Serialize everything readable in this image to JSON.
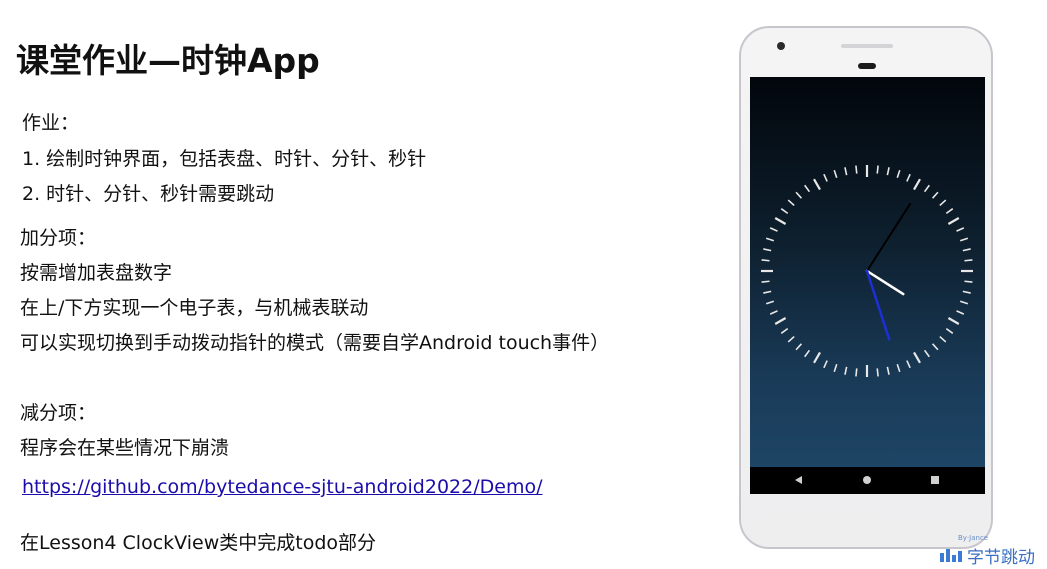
{
  "slide": {
    "title": "课堂作业—时钟App",
    "homework_label": "作业：",
    "homework_items": [
      "1. 绘制时钟界面，包括表盘、时针、分针、秒针",
      "2. 时针、分针、秒针需要跳动"
    ],
    "bonus_label": "加分项：",
    "bonus_items": [
      "按需增加表盘数字",
      "在上/下方实现一个电子表，与机械表联动",
      "可以实现切换到手动拨动指针的模式（需要自学Android touch事件）"
    ],
    "penalty_label": "减分项：",
    "penalty_items": [
      "程序会在某些情况下崩溃"
    ],
    "link_text": "https://github.com/bytedance-sjtu-android2022/Demo/",
    "note": "在Lesson4 ClockView类中完成todo部分"
  },
  "clock": {
    "hour": 4,
    "minute": 5,
    "second": 27,
    "hour_hand_color": "#ffffff",
    "minute_hand_color": "#000000",
    "second_hand_color": "#1d2fd6",
    "tick_color": "#e8e8e8"
  },
  "logo": {
    "small_text": "By·Jance",
    "text": "字节跳动",
    "color": "#3a6fc4"
  }
}
